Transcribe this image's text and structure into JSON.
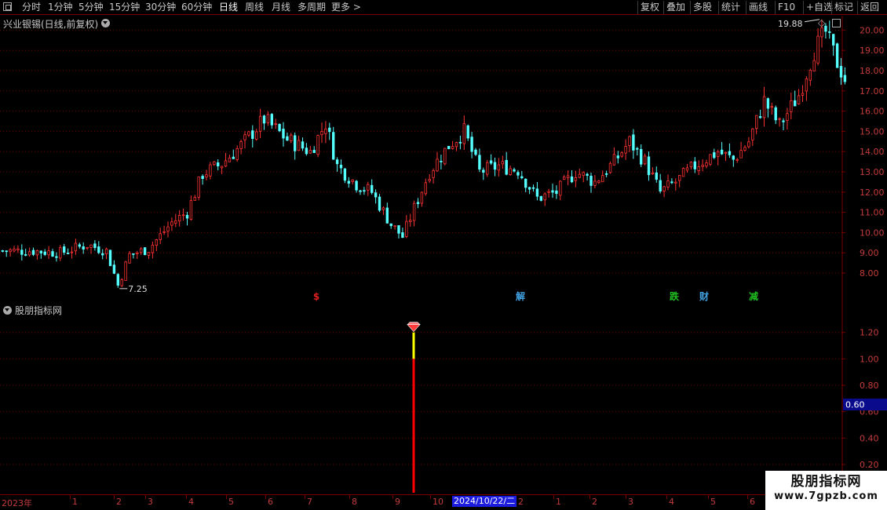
{
  "toolbar": {
    "left_items": [
      "分时",
      "1分钟",
      "5分钟",
      "15分钟",
      "30分钟",
      "60分钟",
      "日线",
      "周线",
      "月线",
      "多周期",
      "更多 >"
    ],
    "active_item": "日线",
    "right_items": [
      "复权",
      "叠加",
      "多股",
      "统计",
      "画线",
      "F10",
      "+自选",
      "标记",
      "返回"
    ]
  },
  "main_chart": {
    "title": "兴业银锡(日线,前复权)",
    "high_label": "19.88",
    "low_label": "7.25",
    "markers": [
      {
        "text": "$",
        "color": "#e02020"
      },
      {
        "text": "解",
        "color": "#40a0e0"
      },
      {
        "text": "跌",
        "color": "#20c020"
      },
      {
        "text": "财",
        "color": "#40a0e0"
      },
      {
        "text": "减",
        "color": "#20c020"
      }
    ]
  },
  "indicator": {
    "title": "股朋指标网",
    "current_value_label": "0.60"
  },
  "date_axis": {
    "cursor_date": "2024/10/22/二",
    "labels": [
      "2023年",
      "1",
      "2",
      "3",
      "4",
      "5",
      "6",
      "7",
      "8",
      "9",
      "10",
      "2",
      "1",
      "2",
      "3",
      "4",
      "5",
      "6"
    ]
  },
  "watermark": {
    "title": "股朋指标网",
    "url": "www.7gpzb.com"
  },
  "colors": {
    "up": "#ff3232",
    "down": "#54ffff",
    "grid": "#7a0000",
    "axis_text": "#c43c3c",
    "signal_top": "#ffff00",
    "signal_main": "#ff0000"
  },
  "chart_data": [
    {
      "type": "candlestick",
      "title": "兴业银锡(日线,前复权)",
      "y_ticks": [
        8.0,
        9.0,
        10.0,
        11.0,
        12.0,
        13.0,
        14.0,
        15.0,
        16.0,
        17.0,
        18.0,
        19.0,
        20.0
      ],
      "ylim": [
        7.0,
        20.4
      ],
      "grid": true,
      "x_period": [
        "2023-12",
        "2025-06"
      ],
      "annotations": [
        {
          "label": "19.88",
          "type": "max"
        },
        {
          "label": "7.25",
          "type": "min"
        }
      ],
      "approx_close_path": [
        [
          0,
          9.1
        ],
        [
          8,
          9.1
        ],
        [
          15,
          9.0
        ],
        [
          22,
          9.4
        ],
        [
          27,
          9.1
        ],
        [
          30,
          7.4
        ],
        [
          33,
          8.9
        ],
        [
          38,
          9.2
        ],
        [
          44,
          10.5
        ],
        [
          48,
          11.0
        ],
        [
          52,
          12.9
        ],
        [
          57,
          13.4
        ],
        [
          62,
          14.3
        ],
        [
          68,
          15.6
        ],
        [
          74,
          14.6
        ],
        [
          80,
          14.0
        ],
        [
          84,
          15.4
        ],
        [
          87,
          13.3
        ],
        [
          92,
          12.4
        ],
        [
          96,
          12.0
        ],
        [
          101,
          10.4
        ],
        [
          104,
          9.8
        ],
        [
          107,
          11.2
        ],
        [
          111,
          13.0
        ],
        [
          116,
          14.3
        ],
        [
          120,
          15.0
        ],
        [
          124,
          13.0
        ],
        [
          129,
          13.3
        ],
        [
          134,
          13.1
        ],
        [
          139,
          11.7
        ],
        [
          144,
          12.0
        ],
        [
          149,
          13.0
        ],
        [
          154,
          12.5
        ],
        [
          159,
          13.5
        ],
        [
          163,
          14.5
        ],
        [
          167,
          13.5
        ],
        [
          171,
          12.0
        ],
        [
          175,
          12.5
        ],
        [
          180,
          13.3
        ],
        [
          186,
          14.0
        ],
        [
          190,
          13.6
        ],
        [
          194,
          14.5
        ],
        [
          198,
          16.5
        ],
        [
          202,
          15.3
        ],
        [
          207,
          16.8
        ],
        [
          211,
          19.0
        ],
        [
          214,
          19.9
        ],
        [
          217,
          18.4
        ],
        [
          219,
          17.6
        ]
      ]
    },
    {
      "type": "bar",
      "title": "股朋指标网",
      "y_ticks": [
        0.2,
        0.4,
        0.6,
        0.8,
        1.0,
        1.2
      ],
      "ylim": [
        0.18,
        1.4
      ],
      "grid": true,
      "signal": {
        "date": "2024/10/22",
        "value_total": 1.2,
        "value_main": 1.0
      }
    }
  ]
}
